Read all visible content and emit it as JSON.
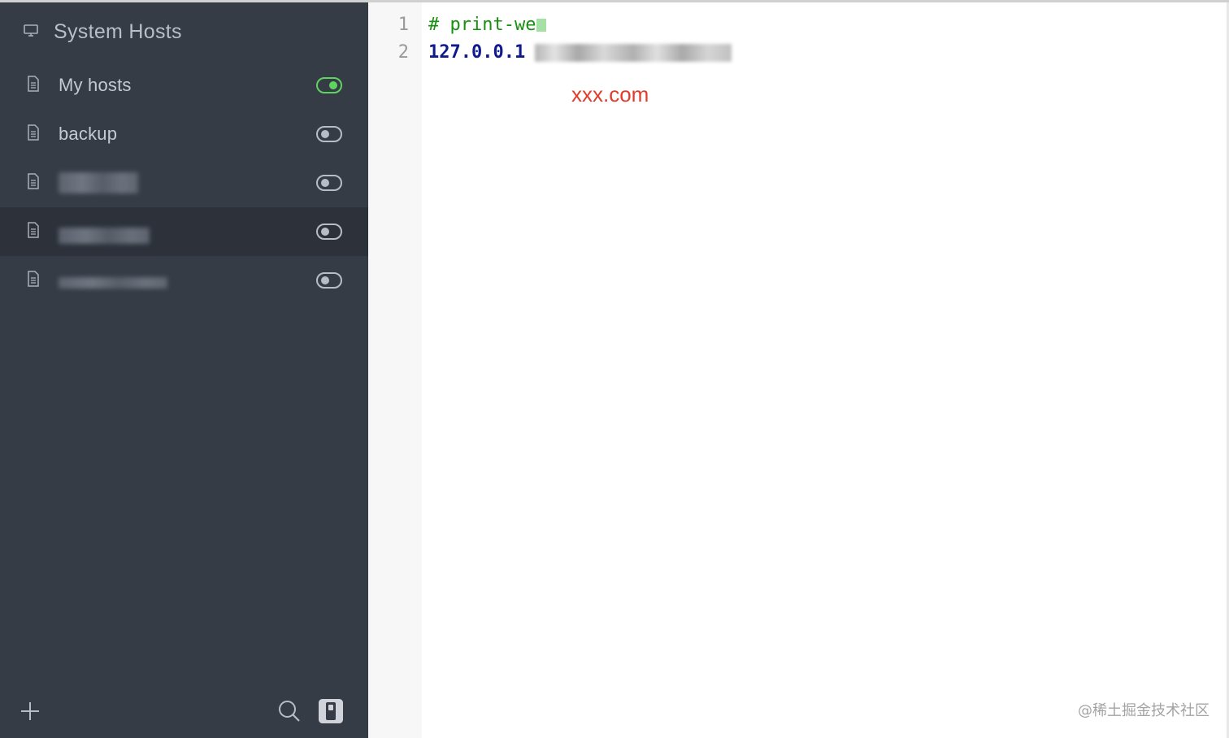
{
  "sidebar": {
    "system_hosts_label": "System Hosts",
    "items": [
      {
        "label": "My hosts",
        "enabled": true
      },
      {
        "label": "backup",
        "enabled": false
      },
      {
        "label": "",
        "enabled": false,
        "redacted": true
      },
      {
        "label": "",
        "enabled": false,
        "redacted": true,
        "selected": true
      },
      {
        "label": "",
        "enabled": false,
        "redacted": true
      }
    ],
    "bottom": {
      "add_glyph": "+",
      "search_icon": "search-icon",
      "mode_icon": "toggle-mode-icon"
    }
  },
  "editor": {
    "line_numbers": [
      "1",
      "2"
    ],
    "line1_comment": "# print-we",
    "line2_ip": "127.0.0.1",
    "annotation": "xxx.com"
  },
  "watermark": "@稀土掘金技术社区",
  "colors": {
    "sidebar_bg": "#363c46",
    "active_row_bg": "#2c313a",
    "toggle_on": "#5fd35f",
    "comment": "#16900f",
    "ip": "#111a8c",
    "annotation": "#e23b2b"
  }
}
